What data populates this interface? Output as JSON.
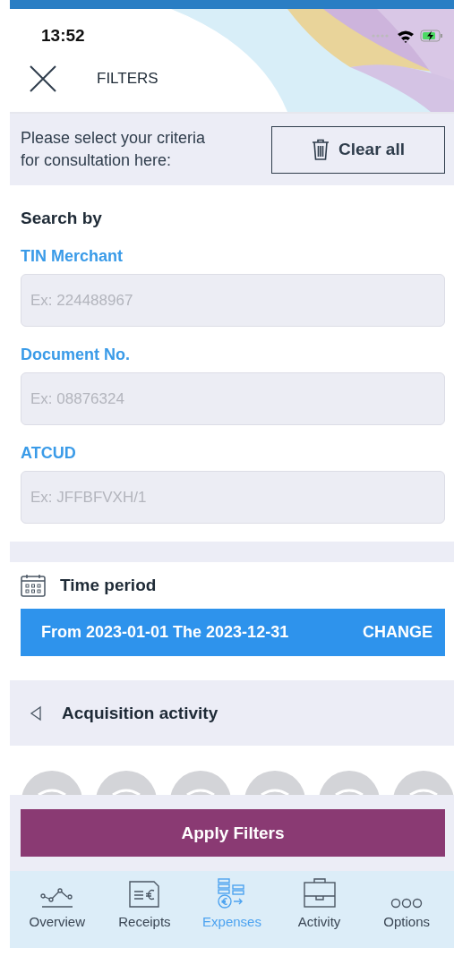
{
  "status_bar": {
    "time": "13:52"
  },
  "header": {
    "title": "FILTERS"
  },
  "intro": {
    "text": "Please select your criteria for consultation here:",
    "button": "Clear all"
  },
  "search": {
    "title": "Search by",
    "fields": [
      {
        "label": "TIN Merchant",
        "placeholder": "Ex: 224488967"
      },
      {
        "label": "Document No.",
        "placeholder": "Ex: 08876324"
      },
      {
        "label": "ATCUD",
        "placeholder": "Ex: JFFBFVXH/1"
      }
    ]
  },
  "time_period": {
    "title": "Time period",
    "range": "From 2023-01-01 The 2023-12-31",
    "action": "CHANGE"
  },
  "acquisition": {
    "title": "Acquisition activity",
    "expanded": false
  },
  "apply_button": "Apply Filters",
  "tabs": [
    {
      "label": "Overview",
      "kind": "chart",
      "selected": false
    },
    {
      "label": "Receipts",
      "kind": "receipt",
      "selected": false
    },
    {
      "label": "Expenses",
      "kind": "coins",
      "selected": true
    },
    {
      "label": "Activity",
      "kind": "briefcase",
      "selected": false
    },
    {
      "label": "Options",
      "kind": "dots",
      "selected": false
    }
  ]
}
